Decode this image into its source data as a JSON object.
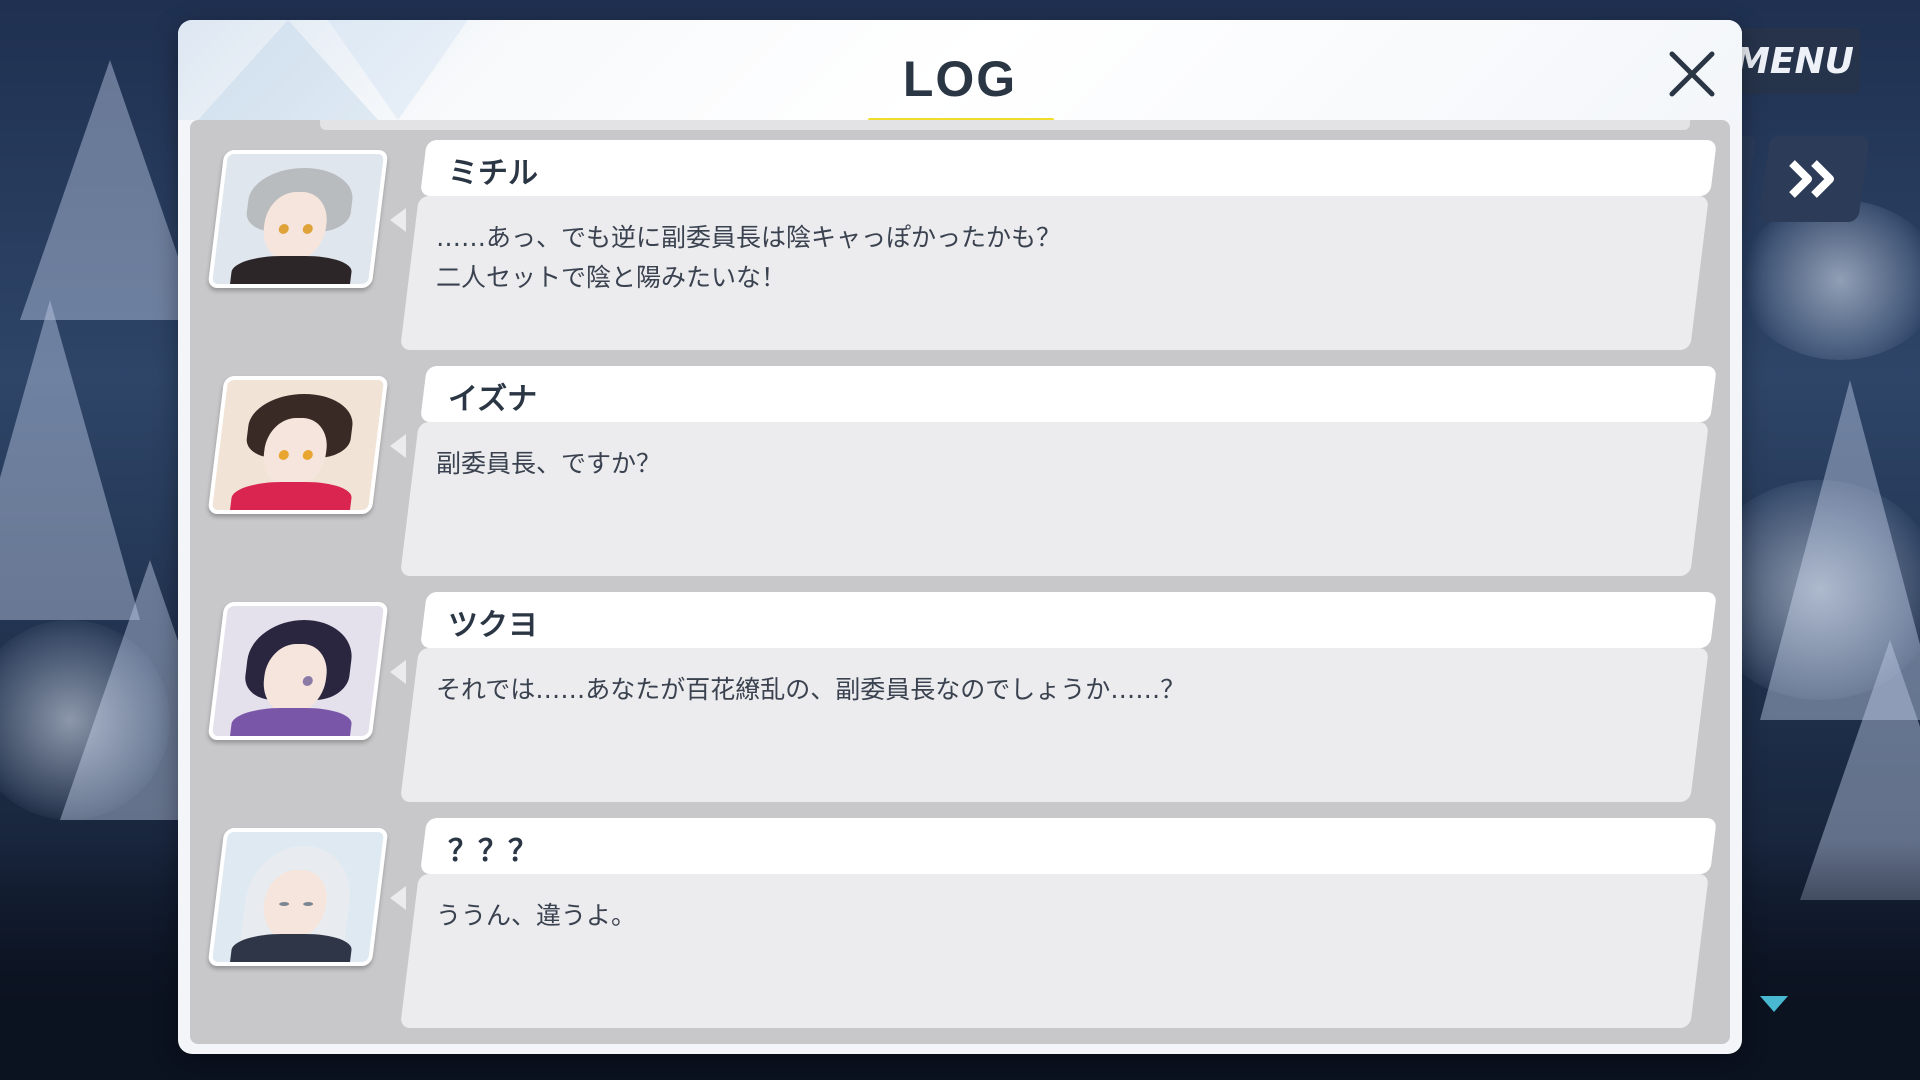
{
  "hud": {
    "menu_label": "MENU",
    "fast_forward_icon": "double-chevron-right-icon"
  },
  "log_panel": {
    "title": "LOG",
    "close_icon": "close-x-icon",
    "accent_color": "#f0dc2a",
    "scroll_indicator_color": "#48b9d0",
    "entries": [
      {
        "speaker": "ミチル",
        "message": "……あっ、でも逆に副委員長は陰キャっぽかったかも？\n二人セットで陰と陽みたいな！",
        "avatar_colors": {
          "hair": "#b9bcbf",
          "body": "#2d2629",
          "eye": "#e0a33a",
          "bg": "#dfe6ee"
        }
      },
      {
        "speaker": "イズナ",
        "message": "副委員長、ですか？",
        "avatar_colors": {
          "hair": "#3a2a26",
          "body": "#d9254f",
          "eye": "#e8a530",
          "bg": "#f1e3d6"
        }
      },
      {
        "speaker": "ツクヨ",
        "message": "それでは……あなたが百花繚乱の、副委員長なのでしょうか……？",
        "avatar_colors": {
          "hair": "#2a2640",
          "body": "#7a56a8",
          "eye": "#8a7aa6",
          "bg": "#e4e0ec"
        }
      },
      {
        "speaker": "？？？",
        "message": "ううん、違うよ。",
        "avatar_colors": {
          "hair": "#e8ecf0",
          "body": "#2e3648",
          "eye": "#7c8796",
          "bg": "#dfe9f2"
        }
      }
    ]
  }
}
